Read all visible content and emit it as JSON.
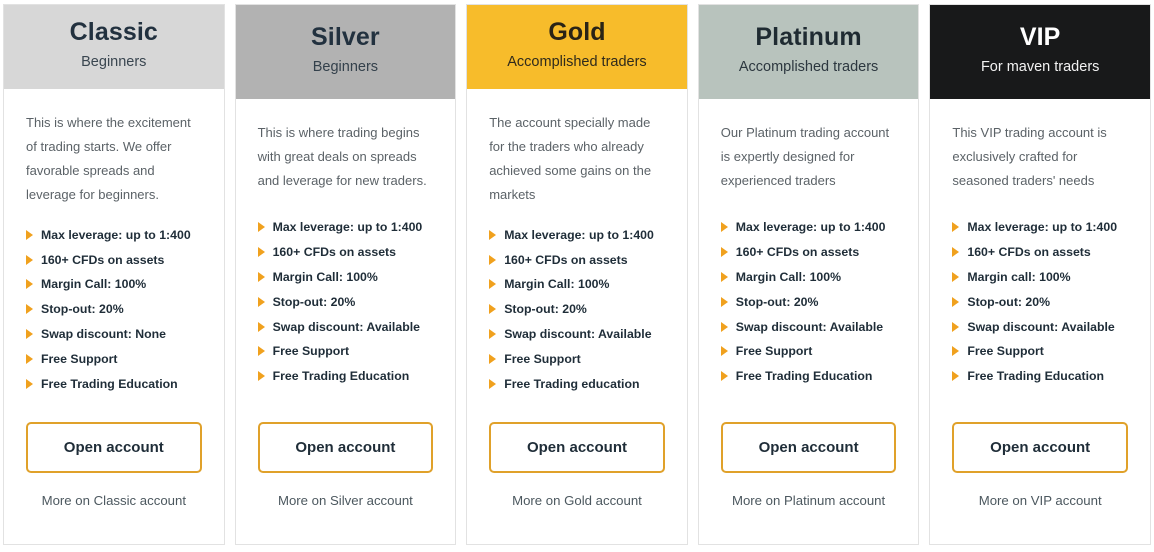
{
  "colors": {
    "accent_orange": "#e0a12a",
    "bullet_orange": "#f0a11e",
    "classic_header_bg": "#d7d7d7",
    "silver_header_bg": "#b2b2b2",
    "gold_header_bg": "#f7bc2b",
    "platinum_header_bg": "#b8c3bd",
    "vip_header_bg": "#18191a",
    "card_border": "#e2e2e2",
    "body_text": "#5b6267",
    "feature_text": "#1f2d38"
  },
  "plans": [
    {
      "id": "classic",
      "name": "Classic",
      "tagline": "Beginners",
      "description": "This is where the excitement of trading starts. We offer favorable spreads and leverage for beginners.",
      "features": [
        "Max leverage: up to 1:400",
        "160+ CFDs on assets",
        "Margin Call: 100%",
        "Stop-out: 20%",
        "Swap discount: None",
        "Free Support",
        "Free Trading Education"
      ],
      "cta_label": "Open account",
      "more_link_label": "More on Classic account"
    },
    {
      "id": "silver",
      "name": "Silver",
      "tagline": "Beginners",
      "description": "This is where trading begins with great deals on spreads and leverage for new traders.",
      "features": [
        "Max leverage: up to 1:400",
        "160+ CFDs on assets",
        "Margin Call: 100%",
        "Stop-out: 20%",
        "Swap discount: Available",
        "Free Support",
        "Free Trading Education"
      ],
      "cta_label": "Open account",
      "more_link_label": "More on Silver account"
    },
    {
      "id": "gold",
      "name": "Gold",
      "tagline": "Accomplished traders",
      "description": "The account specially made for the traders who already achieved some gains on the markets",
      "features": [
        "Max leverage: up to 1:400",
        "160+ CFDs on assets",
        "Margin Call: 100%",
        "Stop-out: 20%",
        "Swap discount: Available",
        "Free Support",
        "Free Trading education"
      ],
      "cta_label": "Open account",
      "more_link_label": "More on Gold account"
    },
    {
      "id": "platinum",
      "name": "Platinum",
      "tagline": "Accomplished traders",
      "description": "Our Platinum trading account is expertly designed for experienced traders",
      "features": [
        "Max leverage: up to 1:400",
        "160+ CFDs on assets",
        "Margin Call: 100%",
        "Stop-out: 20%",
        "Swap discount: Available",
        "Free Support",
        "Free Trading Education"
      ],
      "cta_label": "Open account",
      "more_link_label": "More on Platinum account"
    },
    {
      "id": "vip",
      "name": "VIP",
      "tagline": "For maven traders",
      "description": "This VIP trading account is exclusively crafted for seasoned traders' needs",
      "features": [
        "Max leverage: up to 1:400",
        "160+ CFDs on assets",
        "Margin call: 100%",
        "Stop-out: 20%",
        "Swap discount: Available",
        "Free Support",
        "Free Trading Education"
      ],
      "cta_label": "Open account",
      "more_link_label": "More on VIP account"
    }
  ]
}
